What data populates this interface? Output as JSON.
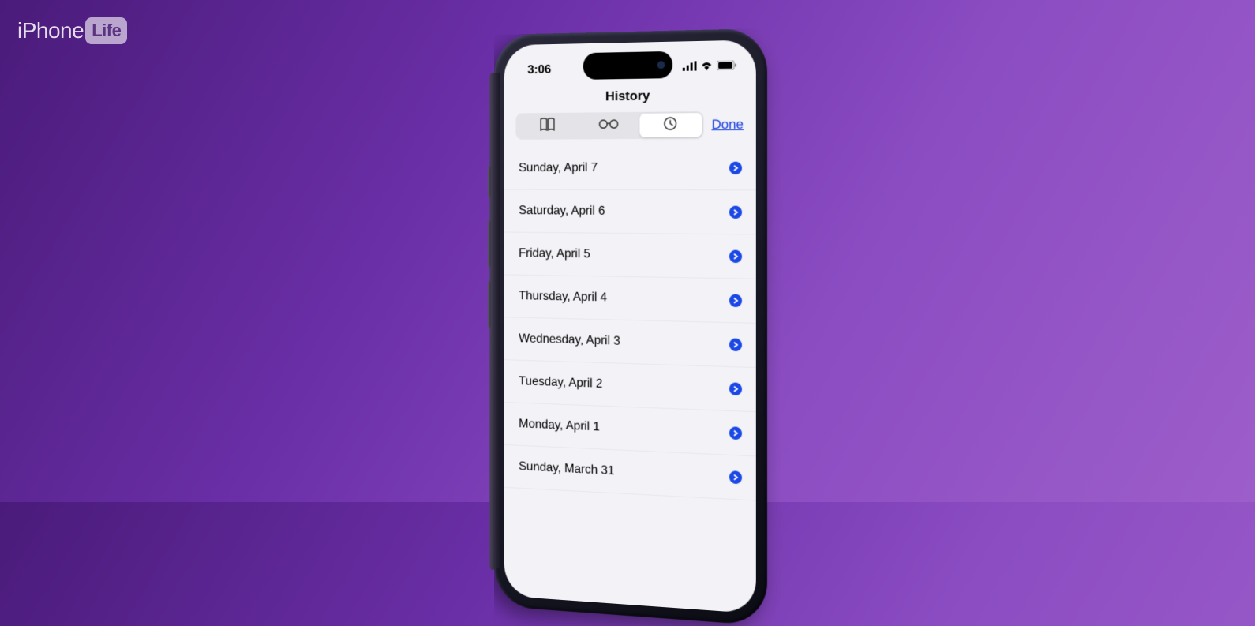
{
  "logo": {
    "brand": "iPhone",
    "badge": "Life"
  },
  "status": {
    "time": "3:06"
  },
  "header": {
    "title": "History",
    "done_label": "Done",
    "tabs": {
      "bookmarks": "bookmarks",
      "readinglist": "reading-list",
      "history": "history",
      "active": "history"
    }
  },
  "history_items": [
    {
      "label": "Sunday, April 7"
    },
    {
      "label": "Saturday, April 6"
    },
    {
      "label": "Friday, April 5"
    },
    {
      "label": "Thursday, April 4"
    },
    {
      "label": "Wednesday, April 3"
    },
    {
      "label": "Tuesday, April 2"
    },
    {
      "label": "Monday, April 1"
    },
    {
      "label": "Sunday, March 31"
    }
  ]
}
